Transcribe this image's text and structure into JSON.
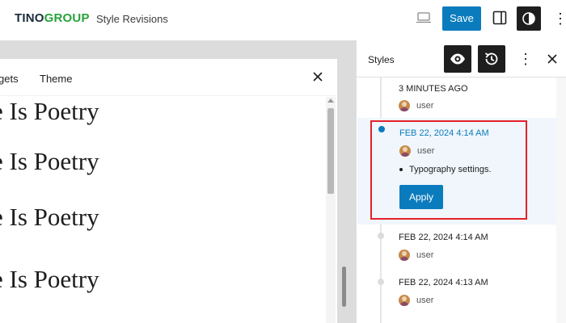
{
  "header": {
    "logo_part1": "TINO",
    "logo_part2": "GROUP",
    "title": "Style Revisions",
    "save_label": "Save",
    "more_label": "⋮"
  },
  "canvas": {
    "tabs": [
      {
        "label": "gets"
      },
      {
        "label": "Theme"
      }
    ],
    "preview_lines": [
      "e Is Poetry",
      "e Is Poetry",
      "e Is Poetry",
      "e Is Poetry"
    ]
  },
  "sidebar": {
    "title": "Styles",
    "more_label": "⋮",
    "revisions": [
      {
        "date": "3 MINUTES AGO",
        "author": "user"
      },
      {
        "date": "FEB 22, 2024 4:14 AM",
        "author": "user",
        "changes": [
          "Typography settings."
        ],
        "apply_label": "Apply",
        "selected": true
      },
      {
        "date": "FEB 22, 2024 4:14 AM",
        "author": "user"
      },
      {
        "date": "FEB 22, 2024 4:13 AM",
        "author": "user"
      }
    ]
  },
  "colors": {
    "accent": "#0a7bbd",
    "highlight": "#e3202a",
    "logo_dark": "#1b2a3a",
    "logo_green": "#26a33a"
  },
  "icons": [
    "desktop-device-icon",
    "sidebar-toggle-icon",
    "styles-contrast-icon",
    "more-vertical-icon",
    "close-icon",
    "eye-icon",
    "history-icon",
    "avatar"
  ]
}
